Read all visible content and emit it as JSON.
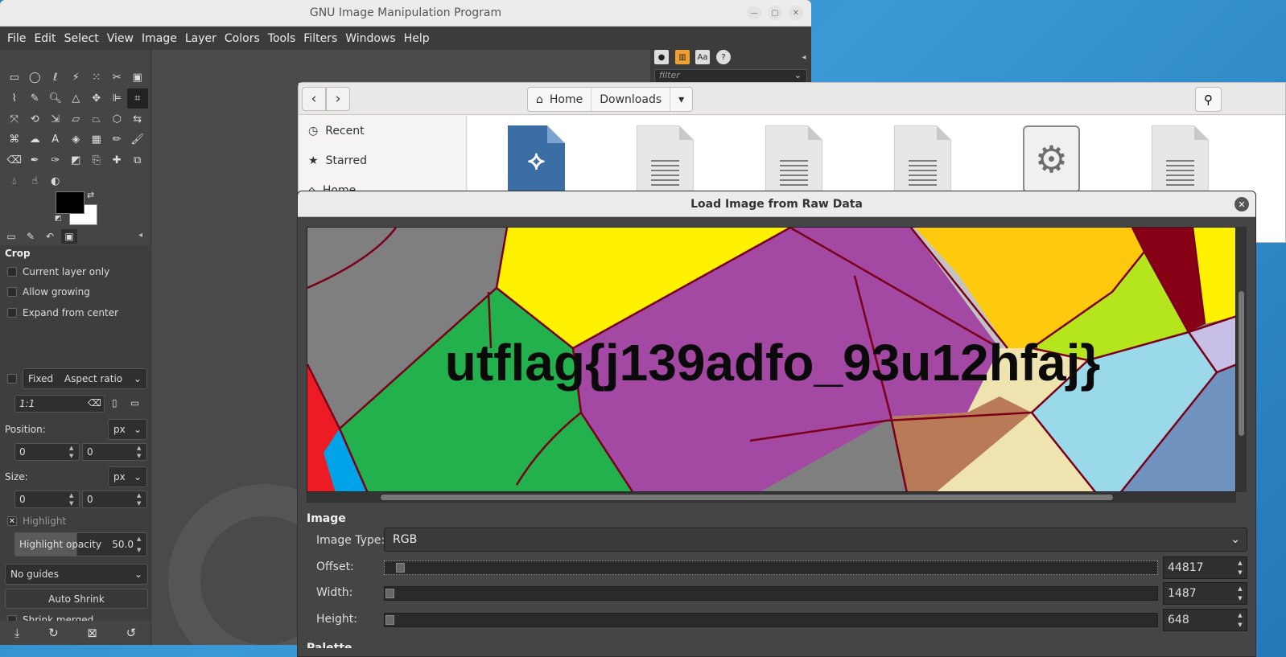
{
  "gimp": {
    "title": "GNU Image Manipulation Program",
    "menu": [
      "File",
      "Edit",
      "Select",
      "View",
      "Image",
      "Layer",
      "Colors",
      "Tools",
      "Filters",
      "Windows",
      "Help"
    ],
    "dock": {
      "filter_placeholder": "filter"
    },
    "tool_options": {
      "title": "Crop",
      "current_layer_only": "Current layer only",
      "allow_growing": "Allow growing",
      "expand_from_center": "Expand from center",
      "fixed_label": "Fixed",
      "fixed_mode": "Aspect ratio",
      "ratio_value": "1:1",
      "position_label": "Position:",
      "position_unit": "px",
      "position_x": "0",
      "position_y": "0",
      "size_label": "Size:",
      "size_unit": "px",
      "size_w": "0",
      "size_h": "0",
      "highlight_label": "Highlight",
      "highlight_opacity_label": "Highlight opacity",
      "highlight_opacity_value": "50.0",
      "guides": "No guides",
      "auto_shrink": "Auto Shrink",
      "shrink_merged": "Shrink merged"
    }
  },
  "file_chooser": {
    "path": [
      "Home",
      "Downloads"
    ],
    "sidebar": [
      "Recent",
      "Starred",
      "Home"
    ],
    "file_icons": [
      "python-file-icon",
      "text-file-icon",
      "text-file-icon",
      "text-file-icon",
      "executable-file-icon",
      "text-file-icon"
    ]
  },
  "raw_dialog": {
    "title": "Load Image from Raw Data",
    "preview_text": "utflag{j139adfo_93u12hfaj}",
    "section_image": "Image",
    "image_type_label": "Image Type:",
    "image_type_value": "RGB",
    "offset_label": "Offset:",
    "offset_value": "44817",
    "width_label": "Width:",
    "width_value": "1487",
    "height_label": "Height:",
    "height_value": "648",
    "section_palette": "Palette"
  },
  "colors": {
    "foreground": "#000000",
    "background": "#ffffff"
  }
}
